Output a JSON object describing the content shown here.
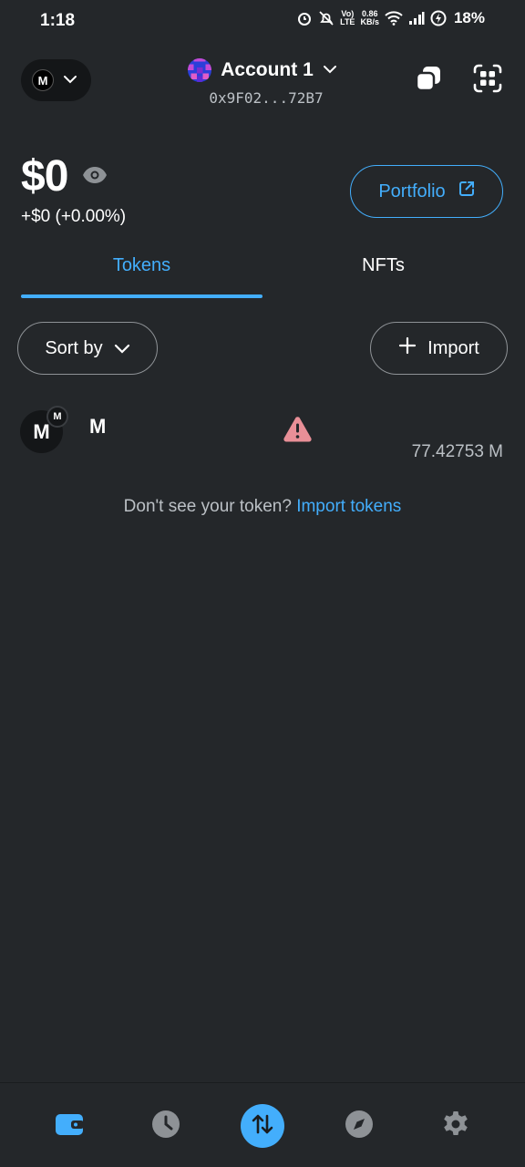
{
  "status_bar": {
    "time": "1:18",
    "lte_label": "LTE",
    "volte_label": "Vo)",
    "speed_value": "0.86",
    "speed_unit": "KB/s",
    "battery": "18%"
  },
  "header": {
    "network_avatar_letter": "M",
    "account_name": "Account 1",
    "account_address": "0x9F02...72B7"
  },
  "balance": {
    "amount": "$0",
    "change": "+$0 (+0.00%)",
    "portfolio_label": "Portfolio"
  },
  "tabs": [
    {
      "label": "Tokens",
      "active": true
    },
    {
      "label": "NFTs",
      "active": false
    }
  ],
  "actions": {
    "sort_label": "Sort by",
    "import_label": "Import"
  },
  "tokens": [
    {
      "avatar_letter": "M",
      "badge_letter": "M",
      "name": "M",
      "amount": "77.42753 M",
      "warning": true
    }
  ],
  "import_hint": {
    "text": "Don't see your token?",
    "link": "Import tokens"
  },
  "bottom_nav": [
    {
      "icon": "wallet-icon",
      "active": true
    },
    {
      "icon": "clock-icon",
      "active": false
    },
    {
      "icon": "swap-icon",
      "active": false
    },
    {
      "icon": "compass-icon",
      "active": false
    },
    {
      "icon": "gear-icon",
      "active": false
    }
  ],
  "colors": {
    "background": "#24272a",
    "accent": "#43aefc",
    "warning": "#e88f97",
    "muted_text": "#bbc0c5"
  }
}
